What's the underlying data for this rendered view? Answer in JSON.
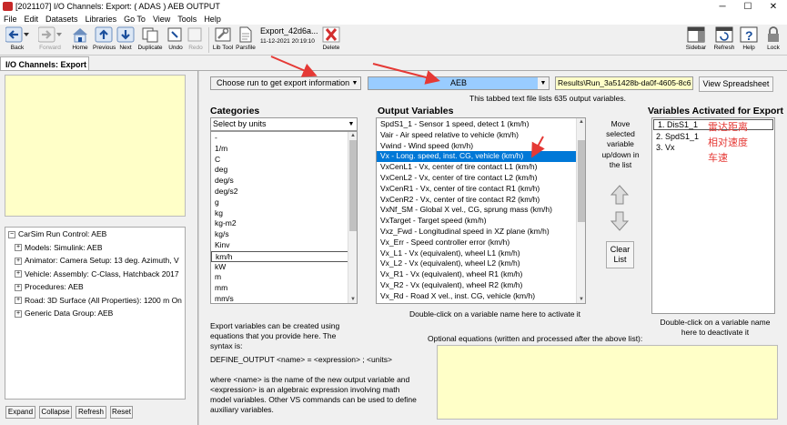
{
  "window": {
    "title": "[2021107] I/O Channels: Export: ( ADAS ) AEB OUTPUT",
    "minimize": "─",
    "maximize": "☐",
    "close": "✕"
  },
  "menu": [
    "File",
    "Edit",
    "Datasets",
    "Libraries",
    "Go To",
    "View",
    "Tools",
    "Help"
  ],
  "toolbar": {
    "back": "Back",
    "forward": "Forward",
    "home": "Home",
    "previous": "Previous",
    "next": "Next",
    "duplicate": "Duplicate",
    "undo": "Undo",
    "redo": "Redo",
    "libtool": "Lib Tool",
    "parsfile": "Parsfile",
    "dataset_name": "Export_42d6a...",
    "dataset_date": "11-12-2021 20:19:10",
    "delete": "Delete",
    "sidebar": "Sidebar",
    "refresh": "Refresh",
    "help": "Help",
    "lock": "Lock"
  },
  "tab": {
    "label": "I/O Channels: Export"
  },
  "run_control": {
    "root": "CarSim Run Control: AEB",
    "items": [
      "Models: Simulink: AEB",
      "Animator: Camera Setup: 13 deg. Azimuth, V",
      "Vehicle: Assembly: C-Class, Hatchback 2017",
      "Procedures: AEB",
      "Road: 3D Surface (All Properties): 1200 m On",
      "Generic Data Group: AEB"
    ]
  },
  "bottom_buttons": {
    "expand": "Expand",
    "collapse": "Collapse",
    "refresh": "Refresh",
    "reset": "Reset"
  },
  "run_select": {
    "choose_run": "Choose run to get export information",
    "selected_run": "AEB",
    "results_path": "Results\\Run_3a51428b-da0f-4605-8c6",
    "view_spreadsheet": "View Spreadsheet",
    "info": "This tabbed text file lists 635 output variables."
  },
  "categories": {
    "heading": "Categories",
    "select_by": "Select by units",
    "items": [
      "-",
      "1/m",
      "C",
      "deg",
      "deg/s",
      "deg/s2",
      "g",
      "kg",
      "kg-m2",
      "kg/s",
      "Kinv",
      "km/h",
      "kW",
      "m",
      "mm",
      "mm/s"
    ],
    "selected_index": 11
  },
  "output_variables": {
    "heading": "Output Variables",
    "items": [
      "SpdS1_1 - Sensor 1 speed, detect 1 (km/h)",
      "Vair - Air speed relative to vehicle (km/h)",
      "Vwind - Wind speed (km/h)",
      "Vx - Long. speed, inst. CG, vehicle (km/h)",
      "VxCenL1 - Vx, center of tire contact L1 (km/h)",
      "VxCenL2 - Vx, center of tire contact L2 (km/h)",
      "VxCenR1 - Vx, center of tire contact R1 (km/h)",
      "VxCenR2 - Vx, center of tire contact R2 (km/h)",
      "VxNf_SM - Global X vel., CG, sprung mass (km/h)",
      "VxTarget - Target speed (km/h)",
      "Vxz_Fwd - Longitudinal speed in XZ plane (km/h)",
      "Vx_Err - Speed controller error (km/h)",
      "Vx_L1 - Vx (equivalent), wheel L1 (km/h)",
      "Vx_L2 - Vx (equivalent), wheel L2 (km/h)",
      "Vx_R1 - Vx (equivalent), wheel R1 (km/h)",
      "Vx_R2 - Vx (equivalent), wheel R2 (km/h)",
      "Vx_Rd - Road X vel., inst. CG, vehicle (km/h)"
    ],
    "selected_index": 3,
    "hint": "Double-click on a variable name here to activate it"
  },
  "move": {
    "text": "Move selected variable up/down in the list",
    "clear_list": "Clear List"
  },
  "activated": {
    "heading": "Variables Activated for Export",
    "items": [
      "1. DisS1_1",
      "2. SpdS1_1",
      "3. Vx"
    ],
    "hint": "Double-click on a variable name here to deactivate it"
  },
  "annotations": [
    "雷达距离",
    "相对速度",
    "车速"
  ],
  "colors": {
    "annotation": "#e53935",
    "arrow": "#e53935",
    "selection": "#0078d7",
    "note_bg": "#ffffc8",
    "run_combo_bg": "#99ccff"
  },
  "help_text": {
    "p1": "Export variables can be created using equations that you provide here. The syntax is:",
    "p2": "DEFINE_OUTPUT <name> = <expression> ; <units>",
    "p3": "where <name> is the name of the new output variable and <expression> is an algebraic expression involving math model variables. Other VS commands can be used to define auxiliary variables."
  },
  "optional_equations": {
    "label": "Optional equations (written and processed after the above list):"
  }
}
